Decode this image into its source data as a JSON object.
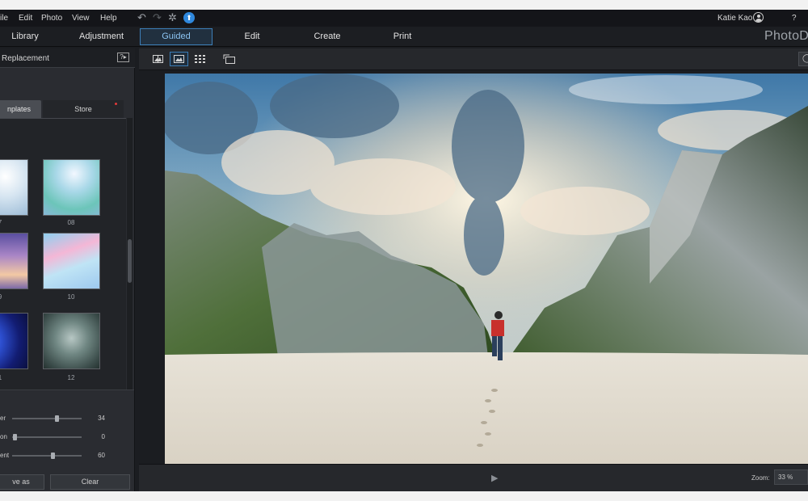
{
  "menu": {
    "items": [
      "ile",
      "Edit",
      "Photo",
      "View",
      "Help"
    ],
    "user_name": "Katie Kao",
    "help": "?",
    "icons": [
      "undo-icon",
      "redo-icon",
      "settings-icon",
      "upgrade-icon"
    ]
  },
  "modes": {
    "tabs": [
      "Library",
      "Adjustment",
      "Guided",
      "Edit",
      "Create",
      "Print"
    ],
    "active": "Guided",
    "brand": "PhotoD"
  },
  "panel": {
    "title": "Replacement",
    "help_icon": "?▸",
    "tabs": [
      "nplates",
      "Store"
    ],
    "active_tab": "nplates",
    "thumbnails": [
      {
        "label": "7",
        "theme": "bright-cloud-sky"
      },
      {
        "label": "08",
        "theme": "rainbow-sky"
      },
      {
        "label": "9",
        "theme": "purple-dusk"
      },
      {
        "label": "10",
        "theme": "pastel-clouds"
      },
      {
        "label": "1",
        "theme": "star-trails"
      },
      {
        "label": "12",
        "theme": "storm-clouds"
      },
      {
        "label": "",
        "theme": "blue-cloud-sky"
      },
      {
        "label": "",
        "theme": "sunset-sky"
      }
    ],
    "sliders": [
      {
        "label": "er",
        "value": "34",
        "level": 0.64
      },
      {
        "label": "on",
        "value": "0",
        "level": 0.04
      },
      {
        "label": "ent",
        "value": "60",
        "level": 0.58
      }
    ],
    "buttons": {
      "save": "ve as",
      "clear": "Clear"
    }
  },
  "toolbar": {
    "icons": [
      "compare-view-icon",
      "single-view-icon",
      "grid-view-icon",
      "rotate-view-icon"
    ],
    "zoom_tool_icon": "zoom-icon"
  },
  "bottom": {
    "play_icon": "▶",
    "zoom_label": "Zoom:",
    "zoom_value": "33 %"
  },
  "colors": {
    "accent": "#3c7fb8",
    "background": "#1b1d21",
    "panel": "#2a2c31"
  }
}
